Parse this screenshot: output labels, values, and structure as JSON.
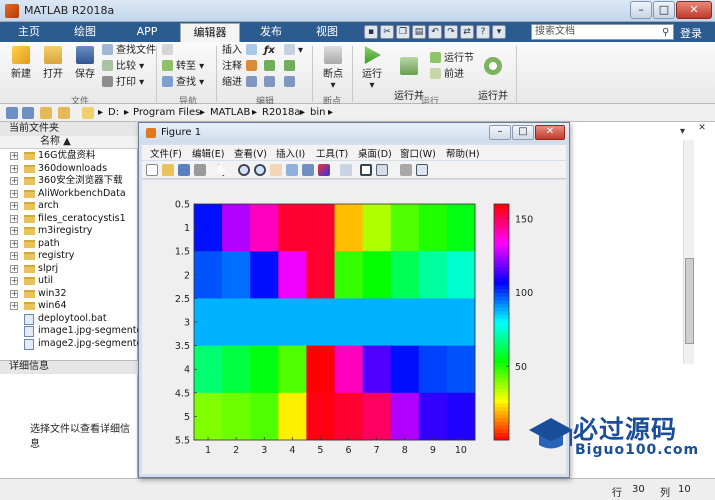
{
  "app": {
    "title": "MATLAB R2018a"
  },
  "window_controls": {
    "minimize": "–",
    "maximize": "□",
    "close": "✕"
  },
  "tabs": [
    "主页",
    "绘图",
    "APP",
    "编辑器",
    "发布",
    "视图"
  ],
  "active_tab": "编辑器",
  "search": {
    "placeholder": "搜索文档"
  },
  "login": "登录",
  "ribbon": {
    "file": {
      "new": "新建",
      "open": "打开",
      "save": "保存",
      "find_files": "查找文件",
      "compare": "比较",
      "print": "打印",
      "group": "文件"
    },
    "navigate": {
      "goto": "转至",
      "find": "查找",
      "group": "导航"
    },
    "edit": {
      "insert": "插入",
      "comment": "注释",
      "indent": "缩进",
      "group": "编辑"
    },
    "breakpoints": {
      "breakpoints": "断点",
      "group": "断点"
    },
    "run": {
      "run": "运行",
      "run_advance": "运行并\n前进",
      "run_section": "运行节",
      "advance": "前进",
      "run_time": "运行并\n计时",
      "group": "运行"
    }
  },
  "address": {
    "drive": "D:",
    "parts": [
      "Program Files",
      "MATLAB",
      "R2018a",
      "bin"
    ],
    "separator": "▸"
  },
  "current_folder": {
    "title": "当前文件夹",
    "column": "名称 ▲",
    "items": [
      {
        "name": "16G优盘资料",
        "type": "folder"
      },
      {
        "name": "360downloads",
        "type": "folder"
      },
      {
        "name": "360安全浏览器下载",
        "type": "folder"
      },
      {
        "name": "AliWorkbenchData",
        "type": "folder"
      },
      {
        "name": "arch",
        "type": "folder"
      },
      {
        "name": "files_ceratocystis1",
        "type": "folder"
      },
      {
        "name": "m3iregistry",
        "type": "folder"
      },
      {
        "name": "path",
        "type": "folder"
      },
      {
        "name": "registry",
        "type": "folder"
      },
      {
        "name": "slprj",
        "type": "folder"
      },
      {
        "name": "util",
        "type": "folder"
      },
      {
        "name": "win32",
        "type": "folder"
      },
      {
        "name": "win64",
        "type": "folder"
      },
      {
        "name": "deploytool.bat",
        "type": "file"
      },
      {
        "name": "image1.jpg-segmente...",
        "type": "file"
      },
      {
        "name": "image2.jpg-segmente...",
        "type": "file"
      }
    ]
  },
  "details": {
    "title": "详细信息",
    "hint": "选择文件以查看详细信息"
  },
  "status": {
    "row_label": "行",
    "row": "30",
    "col_label": "列",
    "col": "10"
  },
  "figure": {
    "title": "Figure 1",
    "menus": [
      "文件(F)",
      "编辑(E)",
      "查看(V)",
      "插入(I)",
      "工具(T)",
      "桌面(D)",
      "窗口(W)",
      "帮助(H)"
    ]
  },
  "chart_data": {
    "type": "heatmap",
    "colormap": "hsv",
    "x": [
      1,
      2,
      3,
      4,
      5,
      6,
      7,
      8,
      9,
      10
    ],
    "y": [
      1,
      2,
      3,
      4,
      5
    ],
    "xticks": [
      1,
      2,
      3,
      4,
      5,
      6,
      7,
      8,
      9,
      10
    ],
    "yticks": [
      0.5,
      1,
      1.5,
      2,
      2.5,
      3,
      3.5,
      4,
      4.5,
      5,
      5.5
    ],
    "ylim": [
      0.5,
      5.5
    ],
    "y_reversed": true,
    "clim": [
      0,
      160
    ],
    "colorbar_ticks": [
      50,
      100,
      150
    ],
    "values": [
      [
        105,
        125,
        140,
        155,
        155,
        20,
        35,
        45,
        50,
        55
      ],
      [
        98,
        95,
        105,
        132,
        155,
        48,
        53,
        62,
        70,
        75
      ],
      [
        88,
        88,
        88,
        88,
        88,
        88,
        88,
        88,
        88,
        88
      ],
      [
        65,
        60,
        55,
        45,
        160,
        140,
        115,
        105,
        100,
        98
      ],
      [
        40,
        42,
        45,
        25,
        158,
        155,
        150,
        125,
        112,
        110
      ]
    ]
  },
  "watermark": {
    "text": "必过源码",
    "url": "Biguo100.com"
  }
}
